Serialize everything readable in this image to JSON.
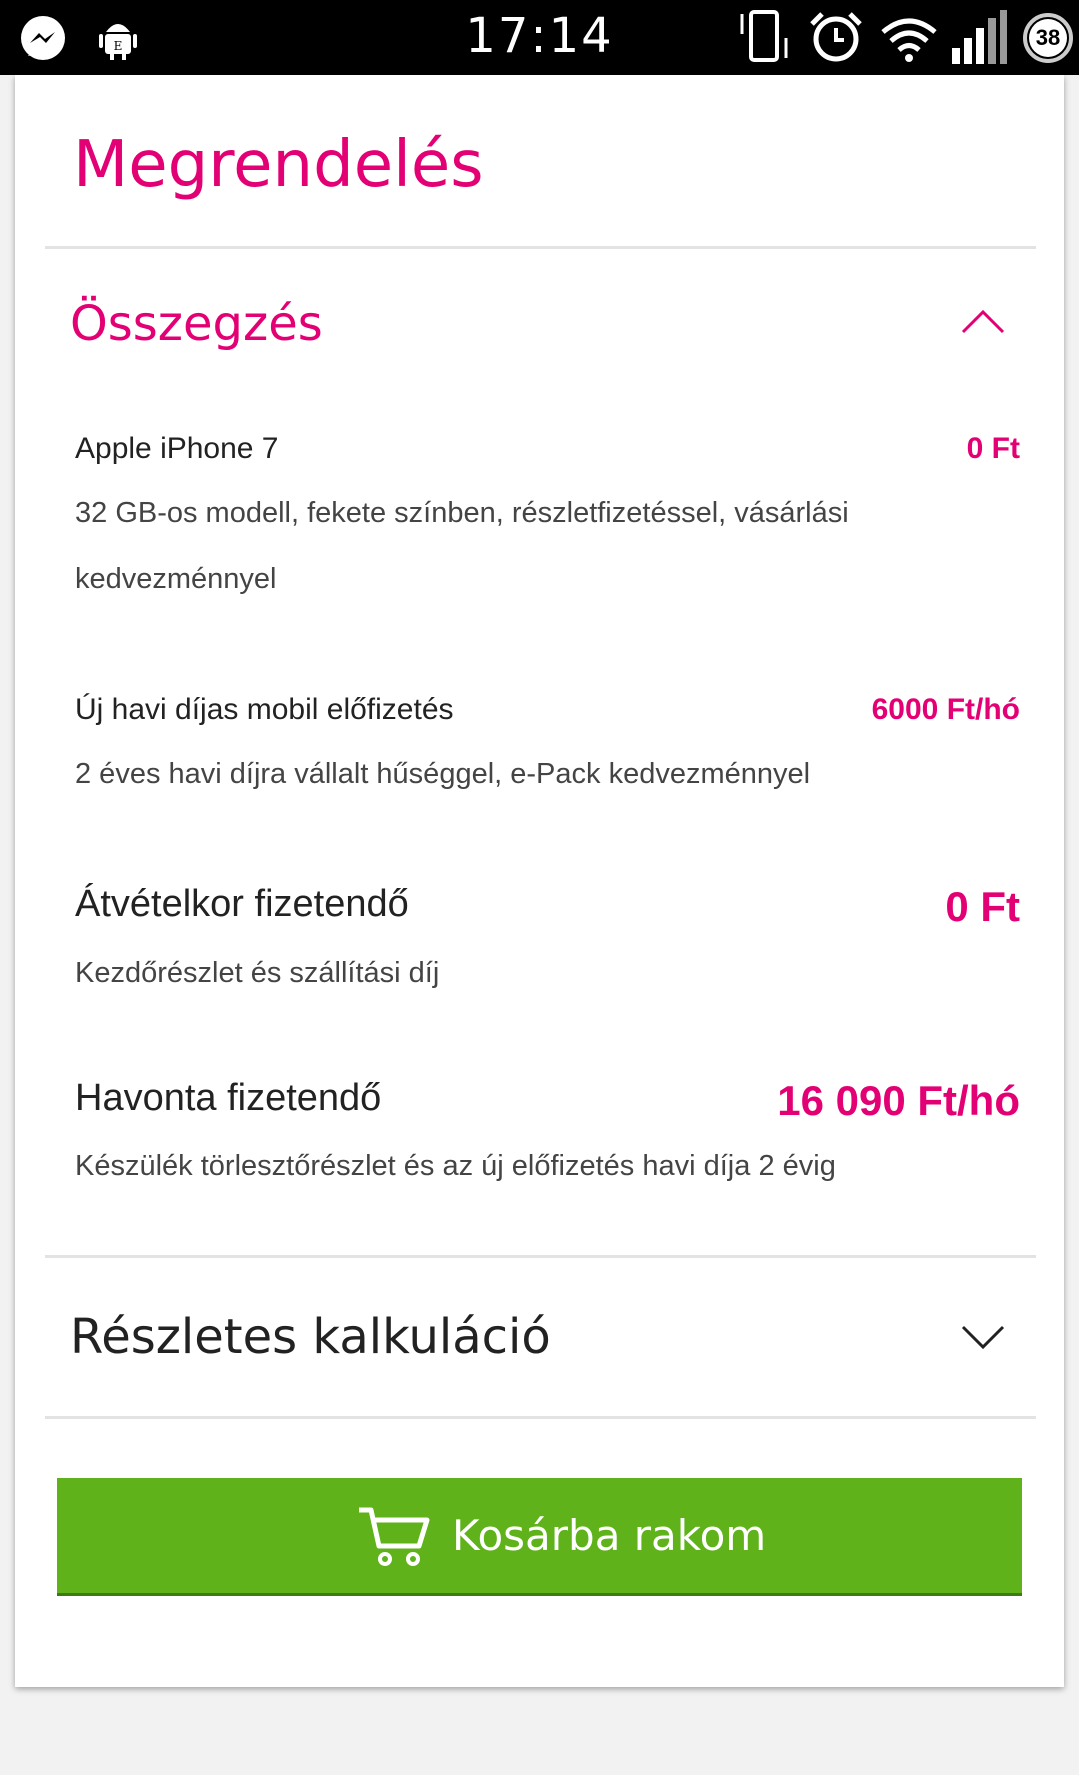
{
  "status_bar": {
    "time": "17:14",
    "battery": "38",
    "left_icons": [
      "messenger-icon",
      "android-debug-icon"
    ],
    "right_icons": [
      "vibrate-icon",
      "alarm-icon",
      "wifi-icon",
      "signal-icon",
      "battery-icon"
    ]
  },
  "page": {
    "title": "Megrendelés"
  },
  "summary": {
    "header": "Összegzés",
    "expanded": true,
    "items": [
      {
        "name": "Apple iPhone 7",
        "price": "0 Ft",
        "description": "32 GB-os modell, fekete színben, részletfizetéssel, vásárlási kedvezménnyel"
      },
      {
        "name": "Új havi díjas mobil előfizetés",
        "price": "6000 Ft/hó",
        "description": "2 éves havi díjra vállalt hűséggel, e-Pack kedvezménnyel"
      },
      {
        "name": "Átvételkor fizetendő",
        "price": "0 Ft",
        "description": "Kezdőrészlet és szállítási díj"
      },
      {
        "name": "Havonta fizetendő",
        "price": "16 090 Ft/hó",
        "description": "Készülék törlesztőrészlet és az új előfizetés havi díja 2 évig"
      }
    ]
  },
  "calculation": {
    "header": "Részletes kalkuláció",
    "expanded": false
  },
  "cart_button": {
    "label": "Kosárba rakom",
    "icon": "cart-icon"
  },
  "colors": {
    "brand": "#e20074",
    "button": "#5fb219",
    "text": "#222222"
  }
}
